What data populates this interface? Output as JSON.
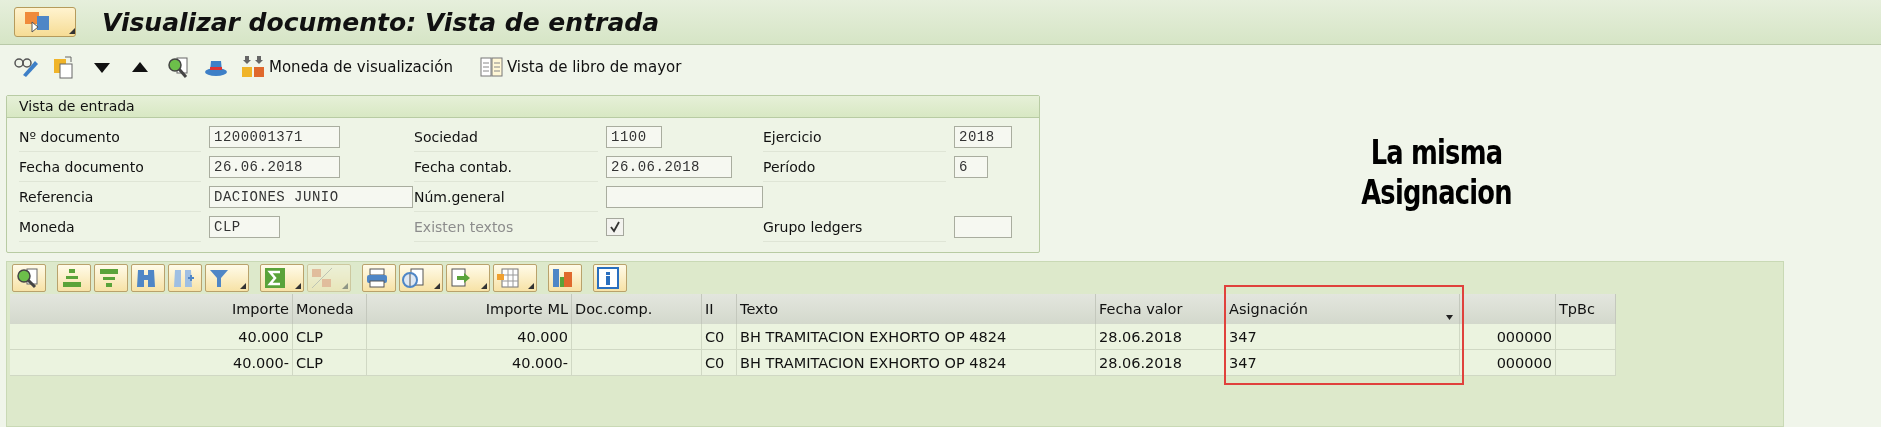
{
  "window": {
    "title": "Visualizar documento: Vista de entrada"
  },
  "toolbar": [
    {
      "kind": "display-change"
    },
    {
      "kind": "document"
    },
    {
      "kind": "down"
    },
    {
      "kind": "up"
    },
    {
      "kind": "find"
    },
    {
      "kind": "hat"
    },
    {
      "kind": "currency",
      "label": "Moneda de visualización"
    },
    {
      "kind": "ledger",
      "label": "Vista de libro de mayor"
    }
  ],
  "header_panel": {
    "title": "Vista de entrada",
    "rows": [
      [
        {
          "label": "Nº documento",
          "value": "1200001371",
          "kind": "field"
        },
        {
          "label": "Sociedad",
          "value": "1100",
          "kind": "field"
        },
        {
          "label": "Ejercicio",
          "value": "2018",
          "kind": "field"
        }
      ],
      [
        {
          "label": "Fecha documento",
          "value": "26.06.2018",
          "kind": "field"
        },
        {
          "label": "Fecha contab.",
          "value": "26.06.2018",
          "kind": "field"
        },
        {
          "label": "Período",
          "value": "6",
          "kind": "field"
        }
      ],
      [
        {
          "label": "Referencia",
          "value": "DACIONES JUNIO",
          "kind": "field"
        },
        {
          "label": "Núm.general",
          "kind": "field"
        }
      ],
      [
        {
          "label": "Moneda",
          "value": "CLP",
          "kind": "field"
        },
        {
          "label": "Existen textos",
          "kind": "checkbox",
          "checked": true,
          "disabled": true
        },
        {
          "label": "Grupo ledgers",
          "kind": "field"
        }
      ]
    ]
  },
  "annotation": {
    "lines": [
      "La misma",
      "Asignacion"
    ]
  },
  "table_toolbar": [
    {
      "kind": "details",
      "menu": false,
      "disabled": false
    },
    {
      "kind": "sort-asc",
      "menu": false,
      "disabled": false
    },
    {
      "kind": "sort-desc",
      "menu": false,
      "disabled": false
    },
    {
      "kind": "find",
      "menu": false,
      "disabled": false
    },
    {
      "kind": "find-next",
      "menu": false,
      "disabled": false
    },
    {
      "kind": "filter",
      "menu": true,
      "disabled": false
    },
    {
      "kind": "sum",
      "menu": true,
      "disabled": false
    },
    {
      "kind": "subtotal",
      "menu": true,
      "disabled": true
    },
    {
      "kind": "print",
      "menu": false,
      "disabled": false
    },
    {
      "kind": "views",
      "menu": true,
      "disabled": false
    },
    {
      "kind": "export",
      "menu": true,
      "disabled": false
    },
    {
      "kind": "layout",
      "menu": true,
      "disabled": false
    },
    {
      "kind": "graphic",
      "menu": false,
      "disabled": false
    },
    {
      "kind": "info",
      "menu": false,
      "disabled": false
    }
  ],
  "table": {
    "columns": [
      {
        "label": "Importe",
        "kind": "number",
        "sorted": false,
        "highlighted": false
      },
      {
        "label": "Moneda",
        "kind": "text",
        "sorted": false,
        "highlighted": false
      },
      {
        "label": "Importe ML",
        "kind": "number",
        "sorted": false,
        "highlighted": false
      },
      {
        "label": "Doc.comp.",
        "kind": "text",
        "sorted": false,
        "highlighted": false
      },
      {
        "label": "II",
        "kind": "text",
        "sorted": false,
        "highlighted": false
      },
      {
        "label": "Texto",
        "kind": "text",
        "sorted": false,
        "highlighted": false
      },
      {
        "label": "Fecha valor",
        "kind": "text",
        "sorted": false,
        "highlighted": false
      },
      {
        "label": "Asignación",
        "kind": "text",
        "sorted": true,
        "highlighted": true
      },
      {
        "kind": "number",
        "sorted": false,
        "highlighted": false
      },
      {
        "label": "TpBc",
        "kind": "text",
        "sorted": false,
        "highlighted": false
      }
    ],
    "rows": [
      [
        "40.000",
        "CLP",
        "40.000",
        "",
        "C0",
        "BH TRAMITACION EXHORTO OP 4824",
        "28.06.2018",
        "347",
        "000000",
        ""
      ],
      [
        "40.000-",
        "CLP",
        "40.000-",
        "",
        "C0",
        "BH TRAMITACION EXHORTO OP 4824",
        "28.06.2018",
        "347",
        "000000",
        ""
      ]
    ]
  }
}
